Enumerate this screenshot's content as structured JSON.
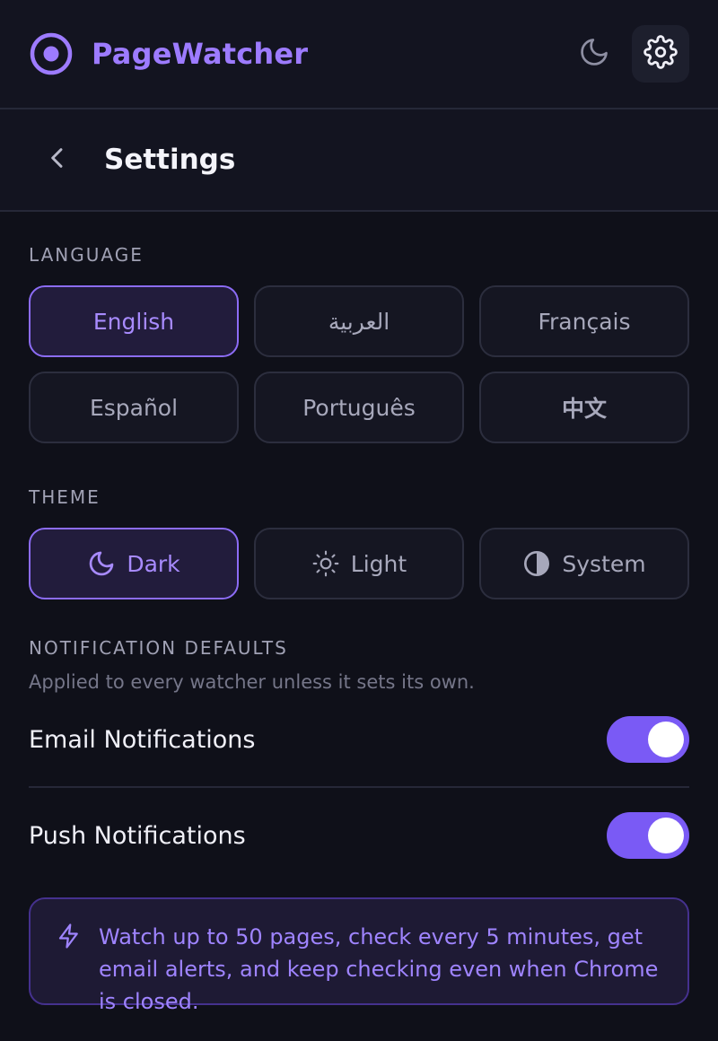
{
  "header": {
    "app_title": "PageWatcher",
    "logo_icon": "radio-target-icon",
    "theme_icon": "moon-icon",
    "settings_icon": "gear-icon"
  },
  "subheader": {
    "back_icon": "chevron-left-icon",
    "title": "Settings"
  },
  "language": {
    "label": "LANGUAGE",
    "options": [
      "English",
      "العربية",
      "Français",
      "Español",
      "Português",
      "中文"
    ],
    "selected": "English"
  },
  "theme": {
    "label": "THEME",
    "options": [
      {
        "label": "Dark",
        "icon": "moon-icon"
      },
      {
        "label": "Light",
        "icon": "sun-icon"
      },
      {
        "label": "System",
        "icon": "half-circle-icon"
      }
    ],
    "selected": "Dark"
  },
  "notifications": {
    "label": "NOTIFICATION DEFAULTS",
    "subtitle": "Applied to every watcher unless it sets its own.",
    "email_label": "Email Notifications",
    "email_enabled": true,
    "push_label": "Push Notifications",
    "push_enabled": true
  },
  "promo": {
    "icon": "lightning-icon",
    "text": "Watch up to 50 pages, check every 5 minutes, get email alerts, and keep checking even when Chrome is closed."
  },
  "colors": {
    "accent": "#9d7bff",
    "background": "#0f1019",
    "toggle_on": "#7a5af5"
  }
}
